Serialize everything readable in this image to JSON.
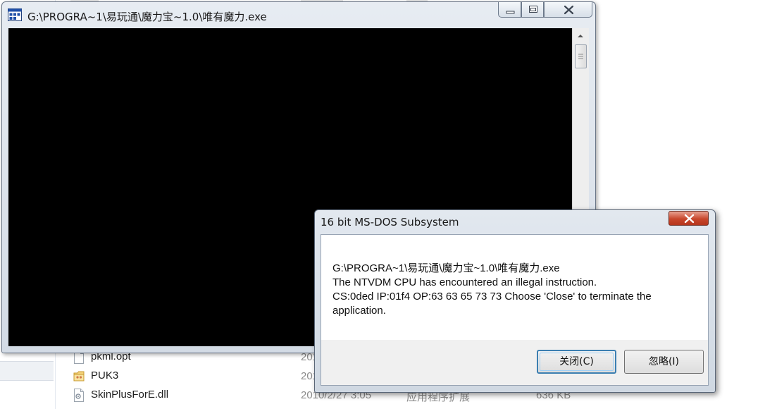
{
  "explorer": {
    "files": [
      {
        "name": "pkml.opt",
        "date": "201",
        "type": "",
        "size": "",
        "icon": "generic-file-icon"
      },
      {
        "name": "PUK3",
        "date": "201",
        "type": "",
        "size": "",
        "icon": "folder-icon"
      },
      {
        "name": "SkinPlusForE.dll",
        "date": "2010/2/27 3:05",
        "type": "应用程序扩展",
        "size": "636 KB",
        "icon": "dll-file-icon"
      }
    ]
  },
  "console": {
    "title": "G:\\PROGRA~1\\易玩通\\魔力宝~1.0\\唯有魔力.exe",
    "screen_color": "#000000"
  },
  "dialog": {
    "title": "16 bit MS-DOS Subsystem",
    "message_lines": [
      "G:\\PROGRA~1\\易玩通\\魔力宝~1.0\\唯有魔力.exe",
      "The NTVDM CPU has encountered an illegal instruction.",
      "CS:0ded IP:01f4 OP:63 63 65 73 73 Choose 'Close' to terminate the application."
    ],
    "buttons": {
      "close_label": "关闭(C)",
      "ignore_label": "忽略(I)"
    },
    "close_button_color": "#c8472c"
  }
}
